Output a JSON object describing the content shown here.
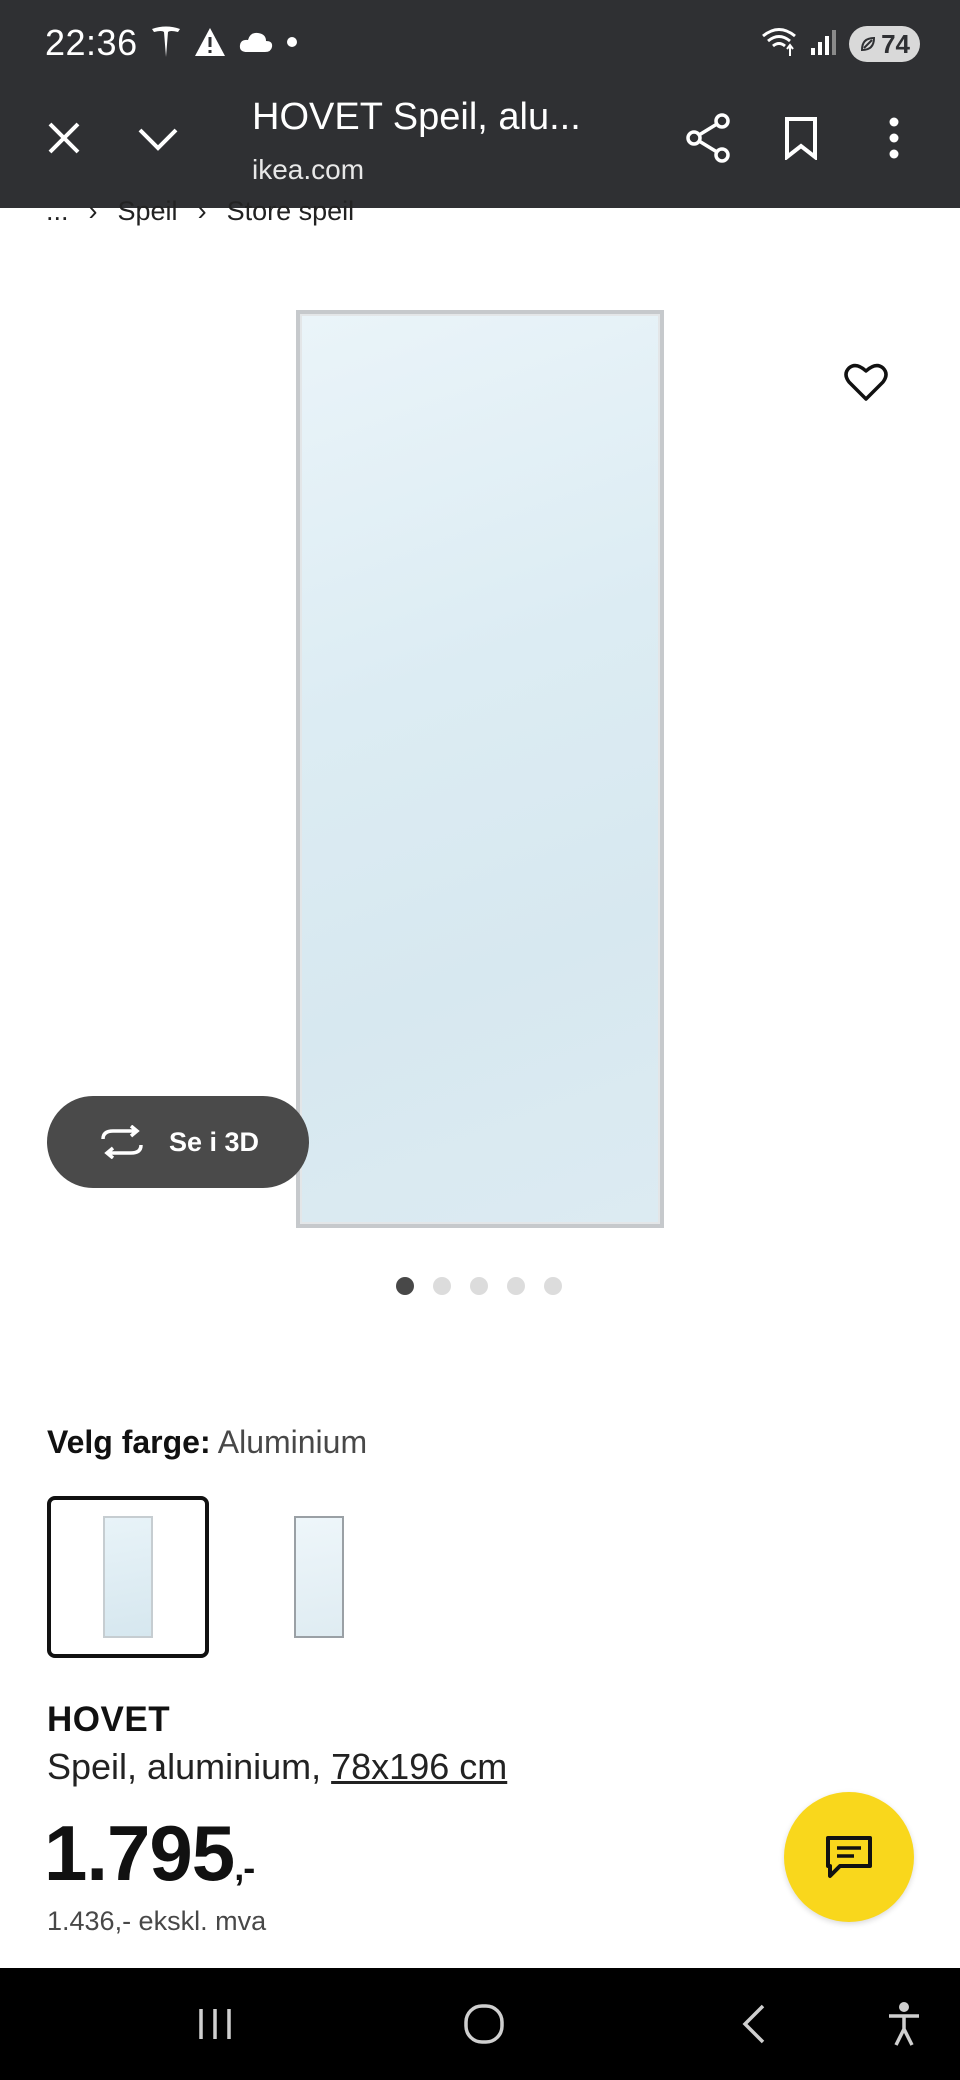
{
  "status_bar": {
    "time": "22:36",
    "battery": "74",
    "icons_left": [
      "tesla-icon",
      "warning-icon",
      "cloud-icon",
      "dot-icon"
    ],
    "icons_right": [
      "wifi-icon",
      "signal-icon",
      "battery-icon"
    ]
  },
  "browser": {
    "title": "HOVET Speil, alu...",
    "url": "ikea.com",
    "icons": [
      "close-icon",
      "chevron-down-icon",
      "share-icon",
      "bookmark-icon",
      "more-vertical-icon"
    ]
  },
  "breadcrumb": {
    "items": [
      "...",
      "Speil",
      "Store speil"
    ],
    "separator": "›"
  },
  "gallery": {
    "view_3d_label": "Se i 3D",
    "dot_count": 5,
    "active_dot": 0
  },
  "color_selector": {
    "label": "Velg farge:",
    "value": "Aluminium",
    "options_count": 2,
    "selected_index": 0
  },
  "product": {
    "name": "HOVET",
    "description": "Speil, aluminium, ",
    "size": "78x196 cm",
    "price": "1.795",
    "price_suffix": ",-",
    "price_ex_vat": "1.436,- ekskl. mva"
  },
  "colors": {
    "chrome_bg": "#2f3033",
    "chat_fab": "#f9d71c",
    "nav_bar": "#000000"
  }
}
